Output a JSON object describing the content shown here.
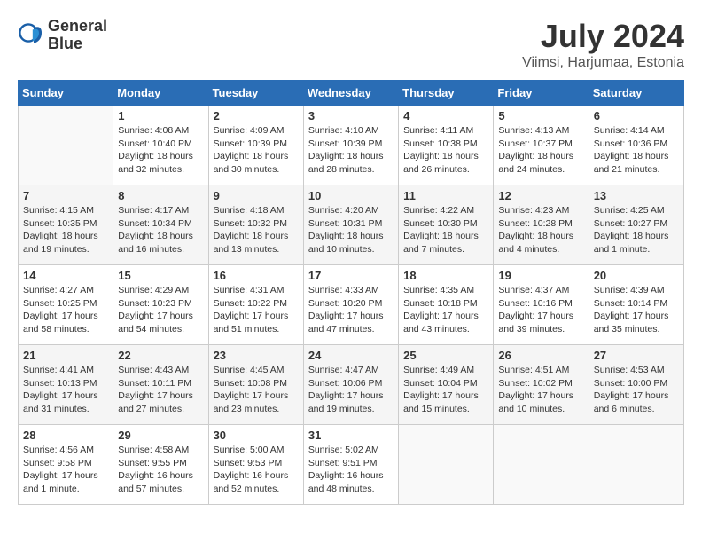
{
  "header": {
    "logo_line1": "General",
    "logo_line2": "Blue",
    "month": "July 2024",
    "location": "Viimsi, Harjumaa, Estonia"
  },
  "weekdays": [
    "Sunday",
    "Monday",
    "Tuesday",
    "Wednesday",
    "Thursday",
    "Friday",
    "Saturday"
  ],
  "weeks": [
    [
      {
        "day": "",
        "info": ""
      },
      {
        "day": "1",
        "info": "Sunrise: 4:08 AM\nSunset: 10:40 PM\nDaylight: 18 hours\nand 32 minutes."
      },
      {
        "day": "2",
        "info": "Sunrise: 4:09 AM\nSunset: 10:39 PM\nDaylight: 18 hours\nand 30 minutes."
      },
      {
        "day": "3",
        "info": "Sunrise: 4:10 AM\nSunset: 10:39 PM\nDaylight: 18 hours\nand 28 minutes."
      },
      {
        "day": "4",
        "info": "Sunrise: 4:11 AM\nSunset: 10:38 PM\nDaylight: 18 hours\nand 26 minutes."
      },
      {
        "day": "5",
        "info": "Sunrise: 4:13 AM\nSunset: 10:37 PM\nDaylight: 18 hours\nand 24 minutes."
      },
      {
        "day": "6",
        "info": "Sunrise: 4:14 AM\nSunset: 10:36 PM\nDaylight: 18 hours\nand 21 minutes."
      }
    ],
    [
      {
        "day": "7",
        "info": "Sunrise: 4:15 AM\nSunset: 10:35 PM\nDaylight: 18 hours\nand 19 minutes."
      },
      {
        "day": "8",
        "info": "Sunrise: 4:17 AM\nSunset: 10:34 PM\nDaylight: 18 hours\nand 16 minutes."
      },
      {
        "day": "9",
        "info": "Sunrise: 4:18 AM\nSunset: 10:32 PM\nDaylight: 18 hours\nand 13 minutes."
      },
      {
        "day": "10",
        "info": "Sunrise: 4:20 AM\nSunset: 10:31 PM\nDaylight: 18 hours\nand 10 minutes."
      },
      {
        "day": "11",
        "info": "Sunrise: 4:22 AM\nSunset: 10:30 PM\nDaylight: 18 hours\nand 7 minutes."
      },
      {
        "day": "12",
        "info": "Sunrise: 4:23 AM\nSunset: 10:28 PM\nDaylight: 18 hours\nand 4 minutes."
      },
      {
        "day": "13",
        "info": "Sunrise: 4:25 AM\nSunset: 10:27 PM\nDaylight: 18 hours\nand 1 minute."
      }
    ],
    [
      {
        "day": "14",
        "info": "Sunrise: 4:27 AM\nSunset: 10:25 PM\nDaylight: 17 hours\nand 58 minutes."
      },
      {
        "day": "15",
        "info": "Sunrise: 4:29 AM\nSunset: 10:23 PM\nDaylight: 17 hours\nand 54 minutes."
      },
      {
        "day": "16",
        "info": "Sunrise: 4:31 AM\nSunset: 10:22 PM\nDaylight: 17 hours\nand 51 minutes."
      },
      {
        "day": "17",
        "info": "Sunrise: 4:33 AM\nSunset: 10:20 PM\nDaylight: 17 hours\nand 47 minutes."
      },
      {
        "day": "18",
        "info": "Sunrise: 4:35 AM\nSunset: 10:18 PM\nDaylight: 17 hours\nand 43 minutes."
      },
      {
        "day": "19",
        "info": "Sunrise: 4:37 AM\nSunset: 10:16 PM\nDaylight: 17 hours\nand 39 minutes."
      },
      {
        "day": "20",
        "info": "Sunrise: 4:39 AM\nSunset: 10:14 PM\nDaylight: 17 hours\nand 35 minutes."
      }
    ],
    [
      {
        "day": "21",
        "info": "Sunrise: 4:41 AM\nSunset: 10:13 PM\nDaylight: 17 hours\nand 31 minutes."
      },
      {
        "day": "22",
        "info": "Sunrise: 4:43 AM\nSunset: 10:11 PM\nDaylight: 17 hours\nand 27 minutes."
      },
      {
        "day": "23",
        "info": "Sunrise: 4:45 AM\nSunset: 10:08 PM\nDaylight: 17 hours\nand 23 minutes."
      },
      {
        "day": "24",
        "info": "Sunrise: 4:47 AM\nSunset: 10:06 PM\nDaylight: 17 hours\nand 19 minutes."
      },
      {
        "day": "25",
        "info": "Sunrise: 4:49 AM\nSunset: 10:04 PM\nDaylight: 17 hours\nand 15 minutes."
      },
      {
        "day": "26",
        "info": "Sunrise: 4:51 AM\nSunset: 10:02 PM\nDaylight: 17 hours\nand 10 minutes."
      },
      {
        "day": "27",
        "info": "Sunrise: 4:53 AM\nSunset: 10:00 PM\nDaylight: 17 hours\nand 6 minutes."
      }
    ],
    [
      {
        "day": "28",
        "info": "Sunrise: 4:56 AM\nSunset: 9:58 PM\nDaylight: 17 hours\nand 1 minute."
      },
      {
        "day": "29",
        "info": "Sunrise: 4:58 AM\nSunset: 9:55 PM\nDaylight: 16 hours\nand 57 minutes."
      },
      {
        "day": "30",
        "info": "Sunrise: 5:00 AM\nSunset: 9:53 PM\nDaylight: 16 hours\nand 52 minutes."
      },
      {
        "day": "31",
        "info": "Sunrise: 5:02 AM\nSunset: 9:51 PM\nDaylight: 16 hours\nand 48 minutes."
      },
      {
        "day": "",
        "info": ""
      },
      {
        "day": "",
        "info": ""
      },
      {
        "day": "",
        "info": ""
      }
    ]
  ]
}
